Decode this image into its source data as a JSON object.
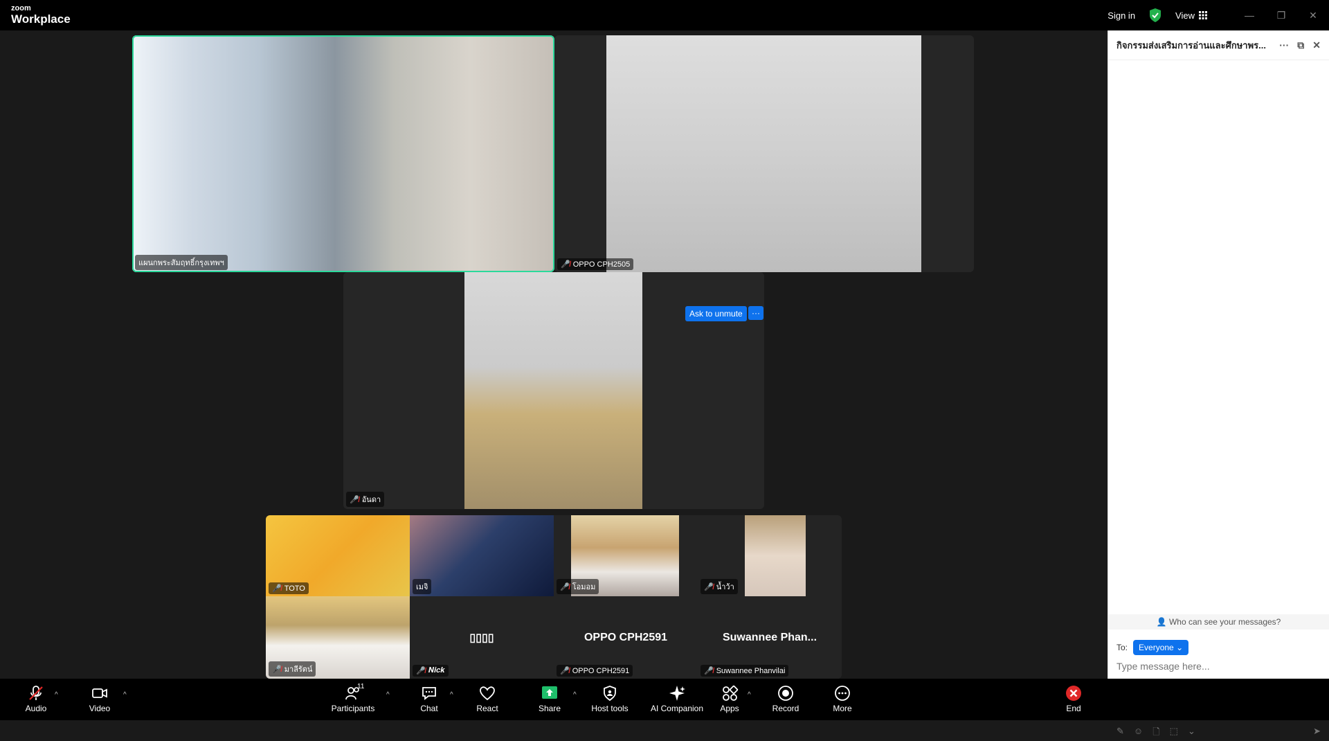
{
  "window": {
    "logo_small": "zoom",
    "logo_big": "Workplace",
    "sign_in": "Sign in",
    "view": "View"
  },
  "tiles": {
    "main_left": {
      "name": "แผนกพระสัมฤทธิ์กรุงเทพฯ"
    },
    "main_right": {
      "name": "OPPO CPH2505"
    },
    "center": {
      "name": "อันดา"
    },
    "ask_unmute": "Ask to unmute",
    "ask_more": "···",
    "row1": [
      {
        "name": "TOTO"
      },
      {
        "name": "เมจิ"
      },
      {
        "name": "โอมอม"
      },
      {
        "name": "น้ำว้า"
      }
    ],
    "row2": [
      {
        "name": "มาลีรัตน์",
        "center": ""
      },
      {
        "name": "𝑵𝒊𝒄𝒌",
        "center": "▯▯▯▯"
      },
      {
        "name": "OPPO CPH2591",
        "center": "OPPO CPH2591"
      },
      {
        "name": "Suwannee  Phanvilai",
        "center": "Suwannee  Phan..."
      }
    ]
  },
  "chat": {
    "title": "กิจกรรมส่งเสริมการอ่านและศึกษาพร...",
    "who_can_see": "Who can see your messages?",
    "to_label": "To:",
    "recipient": "Everyone",
    "placeholder": "Type message here..."
  },
  "toolbar": {
    "audio": "Audio",
    "video": "Video",
    "participants": "Participants",
    "participants_count": "11",
    "chat": "Chat",
    "react": "React",
    "share": "Share",
    "host_tools": "Host tools",
    "ai_companion": "AI Companion",
    "apps": "Apps",
    "record": "Record",
    "more": "More",
    "end": "End"
  },
  "colors": {
    "active_speaker": "#2bd99b",
    "accent": "#0e72ed",
    "share_green": "#1fbe6b",
    "end_red": "#e02828"
  }
}
